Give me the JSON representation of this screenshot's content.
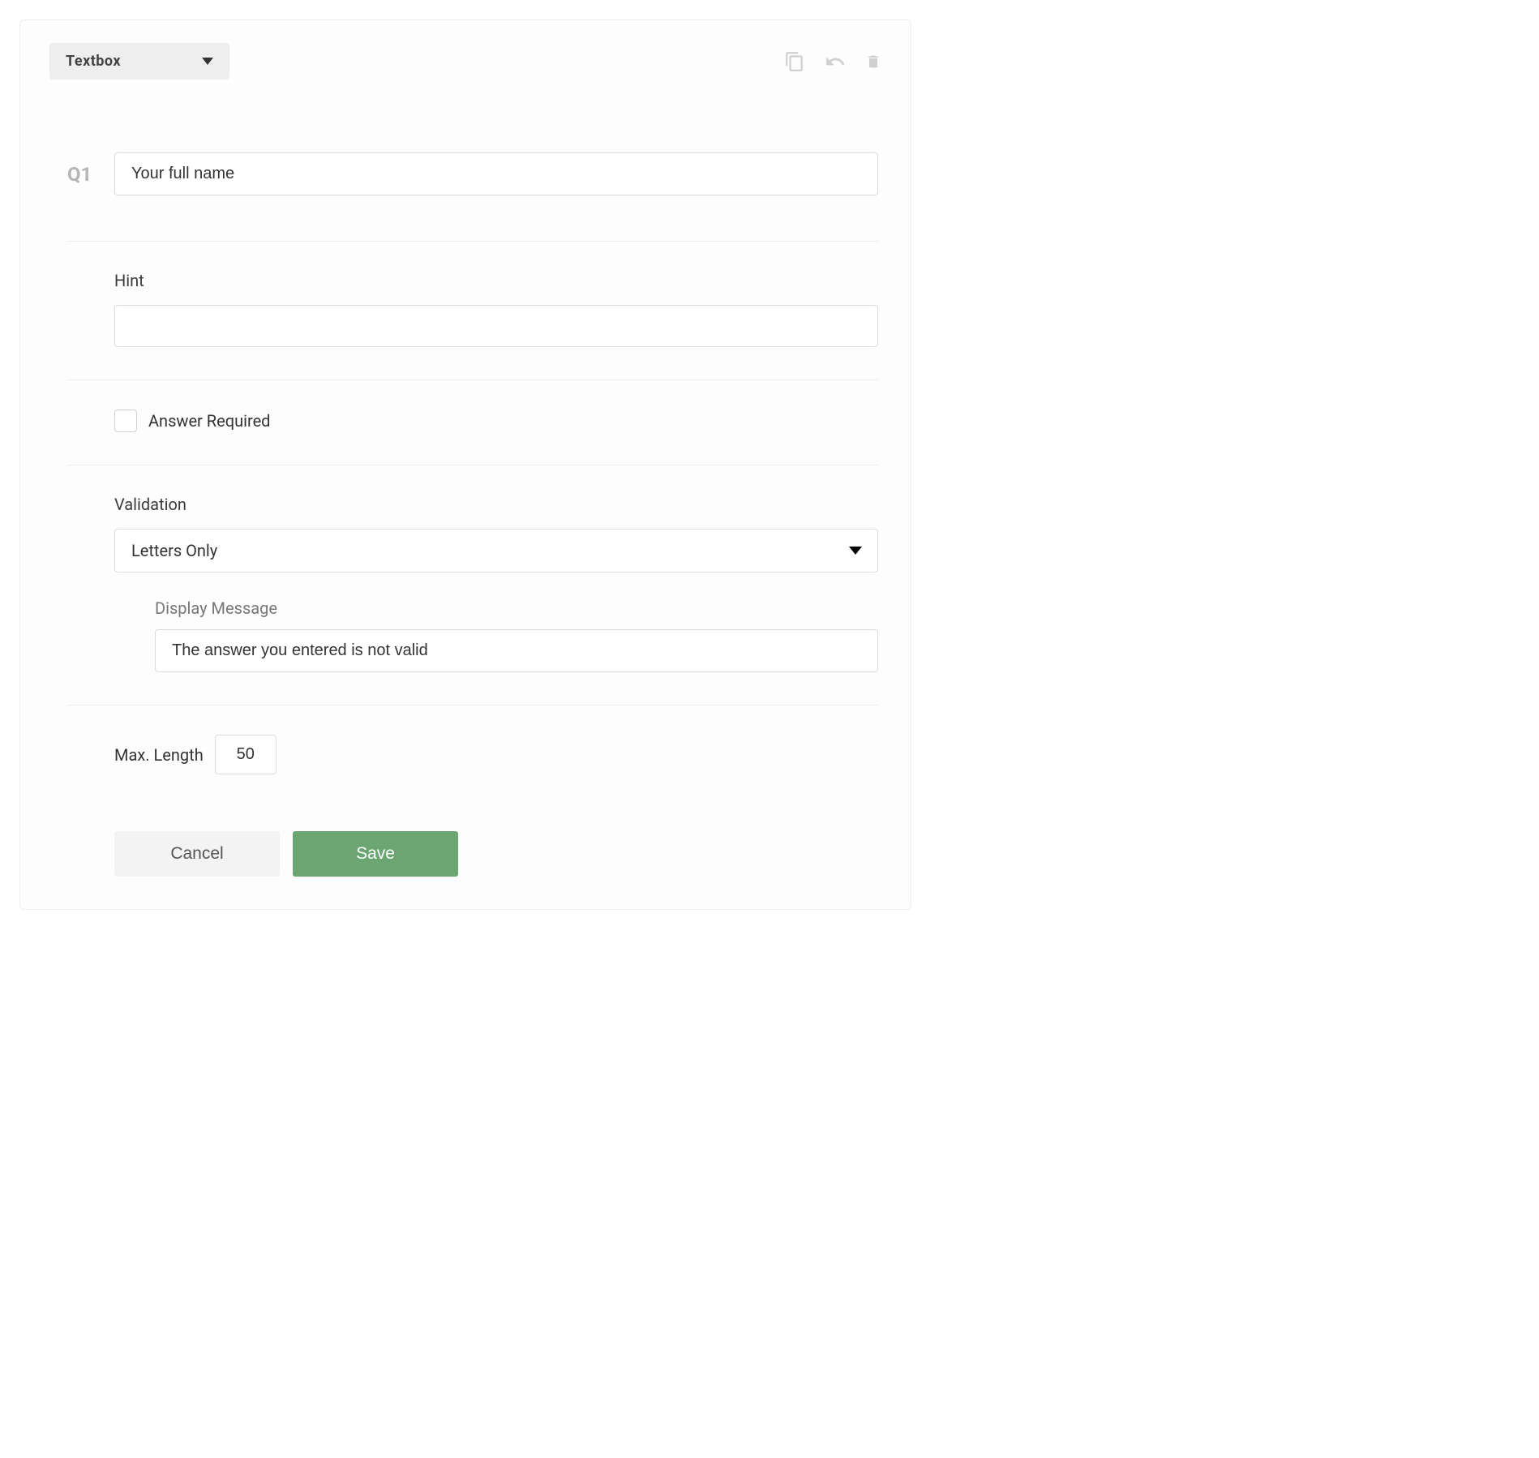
{
  "topbar": {
    "type_selector_label": "Textbox"
  },
  "question": {
    "number_label": "Q1",
    "text_value": "Your full name"
  },
  "hint": {
    "label": "Hint",
    "value": ""
  },
  "required": {
    "label": "Answer Required",
    "checked": false
  },
  "validation": {
    "label": "Validation",
    "selected": "Letters Only",
    "display_message_label": "Display Message",
    "display_message_value": "The answer you entered is not valid"
  },
  "max_length": {
    "label": "Max. Length",
    "value": "50"
  },
  "buttons": {
    "cancel": "Cancel",
    "save": "Save"
  }
}
